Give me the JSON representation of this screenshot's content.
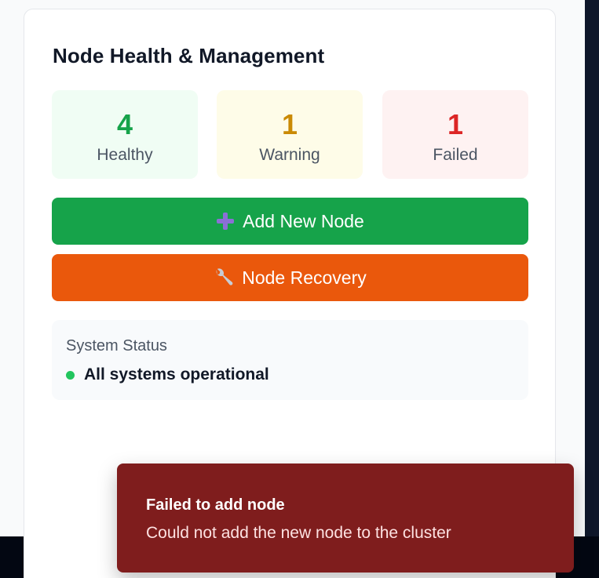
{
  "panel": {
    "title": "Node Health & Management"
  },
  "stats": {
    "healthy": {
      "count": "4",
      "label": "Healthy",
      "color": "#16a34a"
    },
    "warning": {
      "count": "1",
      "label": "Warning",
      "color": "#ca8a04"
    },
    "failed": {
      "count": "1",
      "label": "Failed",
      "color": "#dc2626"
    }
  },
  "actions": {
    "add_node": {
      "label": "Add New Node",
      "icon": "plus-icon",
      "color": "#16a34a"
    },
    "recovery": {
      "label": "Node Recovery",
      "icon": "wrench-icon",
      "color": "#ea580c"
    }
  },
  "system_status": {
    "title": "System Status",
    "message": "All systems operational",
    "indicator_color": "#22c55e"
  },
  "toast": {
    "title": "Failed to add node",
    "message": "Could not add the new node to the cluster",
    "background": "#7f1d1d"
  }
}
